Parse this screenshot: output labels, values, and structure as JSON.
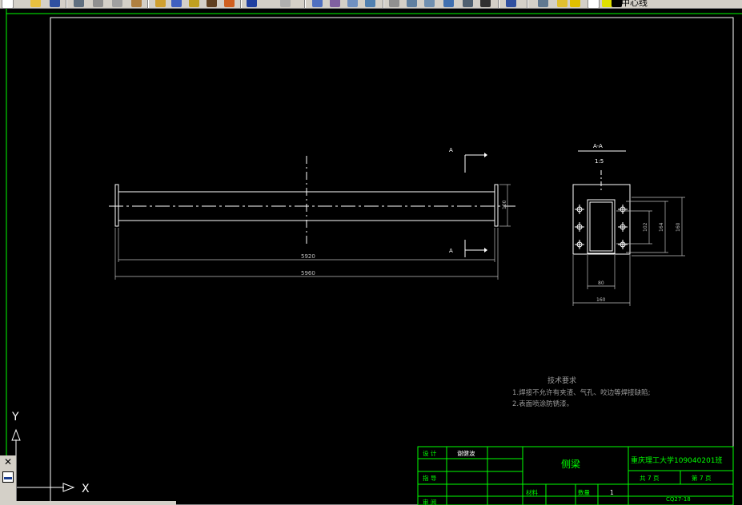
{
  "toolbar": {
    "layer_name": "中心线",
    "buttons": [
      "new-icon",
      "open-icon",
      "save-icon",
      "print-icon",
      "preview-icon",
      "cut-icon",
      "copy-icon",
      "paste-icon",
      "match-icon",
      "undo-icon",
      "redo-icon",
      "pan-icon",
      "zoom-realtime-icon",
      "zoom-window-icon",
      "zoom-previous-icon",
      "properties-icon",
      "design-center-icon",
      "tool-palette-icon",
      "sheet-set-icon",
      "markup-icon",
      "calc-icon",
      "help-icon",
      "layer-manager-icon",
      "layer-state-icon"
    ]
  },
  "drawing": {
    "section_label_top": "A",
    "section_label_bottom": "A",
    "overall_length_inner": "5920",
    "overall_length_outer": "5960",
    "height_dim_main": "100",
    "section_title": "A-A",
    "section_scale": "1:5",
    "dim_inner_h": "102",
    "dim_bolt_h": "164",
    "dim_outer_h": "160",
    "dim_inner_w": "80",
    "dim_outer_w": "160"
  },
  "notes": {
    "title": "技术要求",
    "line1": "1.焊接不允许有夹渣、气孔、咬边等焊接缺陷;",
    "line2": "2.表面喷涂防锈漆。"
  },
  "title_block": {
    "design_label": "设 计",
    "designer_name": "谢健波",
    "guide_label": "指 导",
    "review_label": "审 阅",
    "part_name": "侧梁",
    "school": "重庆理工大学109040201班",
    "total_pages": "共 7 页",
    "page_no": "第 7 页",
    "material_label": "材料",
    "quantity_label": "数量",
    "quantity_value": "1",
    "drawing_no": "CQ27-18"
  },
  "ucs": {
    "x_label": "X",
    "y_label": "Y"
  },
  "colors": {
    "background": "#000000",
    "frame": "#ffffff",
    "title_block": "#00ff00",
    "dimension": "#bfbfbf",
    "notes": "#9a9a9a"
  }
}
